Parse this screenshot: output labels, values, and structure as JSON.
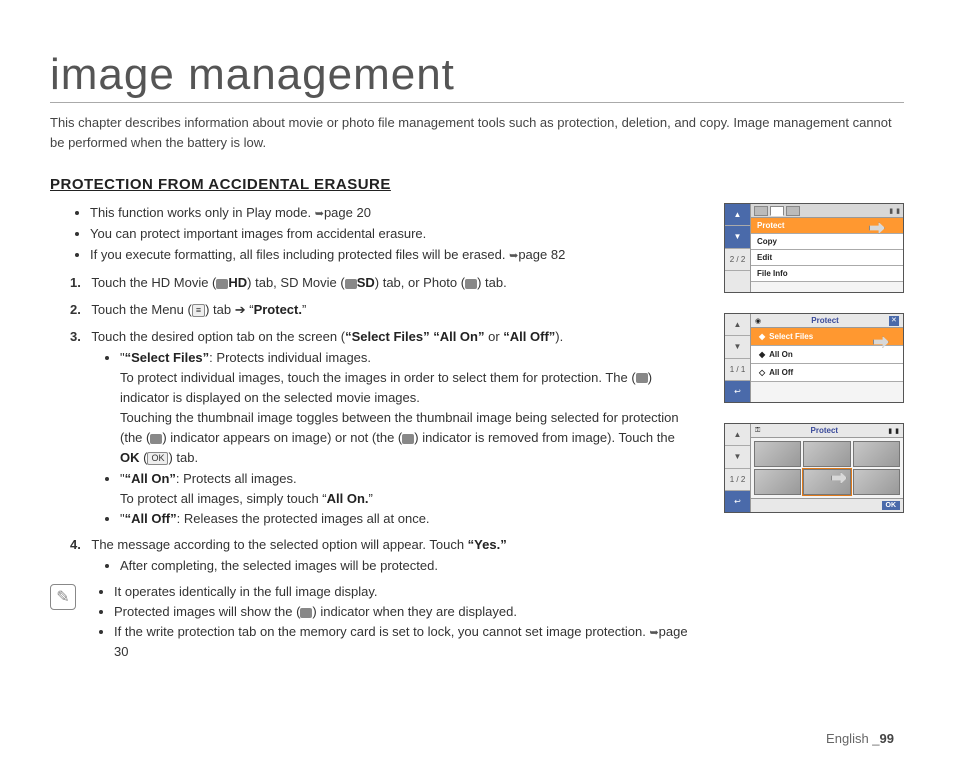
{
  "title": "image management",
  "intro": "This chapter describes information about movie or photo file management tools such as protection, deletion, and copy. Image management cannot be performed when the battery is low.",
  "section_heading": "PROTECTION FROM ACCIDENTAL ERASURE",
  "bullets": {
    "b1_pre": "This function works only in Play mode. ",
    "b1_link": "page 20",
    "b2": "You can protect important images from accidental erasure.",
    "b3_pre": "If you execute formatting, all files including protected files will be erased. ",
    "b3_link": "page 82"
  },
  "steps": {
    "s1_num": "1.",
    "s1_a": "Touch the HD Movie (",
    "s1_hd": "HD",
    "s1_b": ") tab, SD Movie (",
    "s1_sd": "SD",
    "s1_c": ") tab, or Photo (",
    "s1_d": ") tab.",
    "s2_num": "2.",
    "s2_a": "Touch the Menu (",
    "s2_b": ") tab ➔ “",
    "s2_protect": "Protect.",
    "s2_c": "”",
    "s3_num": "3.",
    "s3_text": "Touch the desired option tab on the screen (",
    "s3_opts": "“Select Files” “All On”",
    "s3_or": " or ",
    "s3_alloff": "“All Off”",
    "s3_end": ").",
    "s3_sf_label": "“Select Files”",
    "s3_sf_a": ": Protects individual images.",
    "s3_sf_b": "To protect individual images, touch the images in order to select them for protection. The (",
    "s3_sf_c": ") indicator is displayed on the selected movie images.",
    "s3_sf_d": "Touching the thumbnail image toggles between the thumbnail image being selected for protection (the (",
    "s3_sf_e": ") indicator appears on image) or not (the (",
    "s3_sf_f": ") indicator is removed from image). Touch the ",
    "s3_sf_ok": "OK",
    "s3_sf_g": " (",
    "s3_sf_okbtn": "OK",
    "s3_sf_h": ") tab.",
    "s3_ao_label": "“All On”",
    "s3_ao_a": ": Protects all images.",
    "s3_ao_b": "To protect all images, simply touch “",
    "s3_ao_c": "All On.",
    "s3_ao_d": "”",
    "s3_af_label": "“All Off”",
    "s3_af_a": ": Releases the protected images all at once.",
    "s4_num": "4.",
    "s4_a": "The message according to the selected option will appear. Touch ",
    "s4_yes": "“Yes.”",
    "s4_b": "After completing, the selected images will be protected."
  },
  "notes": {
    "n1": "It operates identically in the full image display.",
    "n2_a": "Protected images will show the (",
    "n2_b": ") indicator when they are displayed.",
    "n3_a": "If the write protection tab on the memory card is set to lock, you cannot set image protection. ",
    "n3_link": "page 30"
  },
  "mini1": {
    "page": "2 / 2",
    "rows": [
      "Protect",
      "Copy",
      "Edit",
      "File Info"
    ]
  },
  "mini2": {
    "title": "Protect",
    "page": "1 / 1",
    "rows": [
      "Select Files",
      "All On",
      "All Off"
    ]
  },
  "mini3": {
    "title": "Protect",
    "page": "1 / 2",
    "ok": "OK"
  },
  "footer": {
    "lang": "English ",
    "sep": "_",
    "page": "99"
  }
}
